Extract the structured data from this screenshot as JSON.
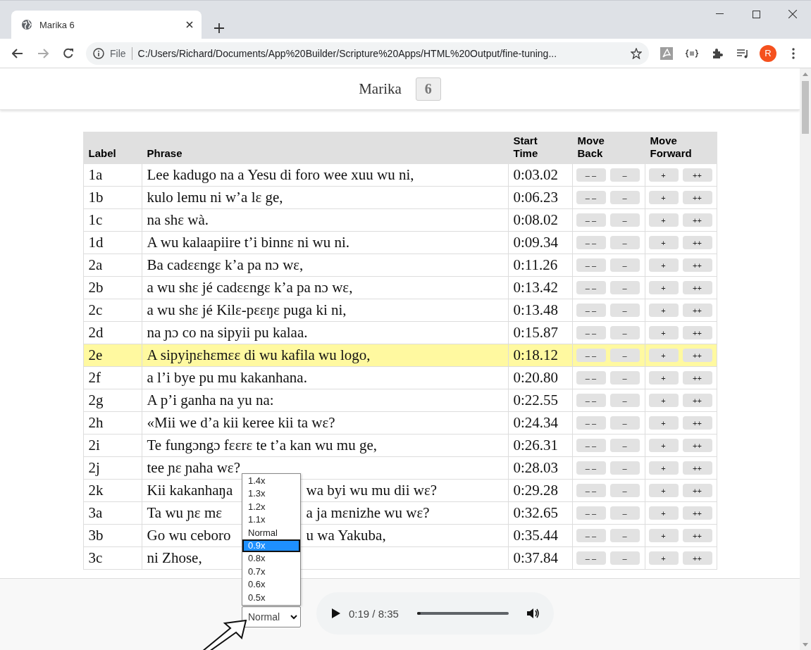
{
  "browser": {
    "tab": {
      "title": "Marika 6",
      "selected": true
    },
    "address": {
      "scheme": "File",
      "url": "C:/Users/Richard/Documents/App%20Builder/Scripture%20Apps/HTML%20Output/fine-tuning..."
    },
    "profile": "R"
  },
  "header": {
    "title": "Marika",
    "chapter": "6"
  },
  "table": {
    "columns": [
      {
        "lines": [
          "Label"
        ]
      },
      {
        "lines": [
          "Phrase"
        ]
      },
      {
        "lines": [
          "Start",
          "Time"
        ]
      },
      {
        "lines": [
          "Move",
          "Back"
        ]
      },
      {
        "lines": [
          "Move",
          "Forward"
        ]
      }
    ],
    "rows": [
      {
        "label": "1a",
        "phrase": [
          "Lee kadugo na a Yesu di foro wee xuu wu ni,"
        ],
        "start": "0:03.02",
        "back": [
          "– –",
          "–"
        ],
        "forward": [
          "+",
          "++"
        ],
        "selected": false
      },
      {
        "label": "1b",
        "phrase": [
          "kulo lemu ni w’a lɛ ge,"
        ],
        "start": "0:06.23",
        "back": [
          "– –",
          "–"
        ],
        "forward": [
          "+",
          "++"
        ],
        "selected": false
      },
      {
        "label": "1c",
        "phrase": [
          "na shɛ wà."
        ],
        "start": "0:08.02",
        "back": [
          "– –",
          "–"
        ],
        "forward": [
          "+",
          "++"
        ],
        "selected": false
      },
      {
        "label": "1d",
        "phrase": [
          "A wu kalaapiire t’i binnɛ ni wu ni."
        ],
        "start": "0:09.34",
        "back": [
          "– –",
          "–"
        ],
        "forward": [
          "+",
          "++"
        ],
        "selected": false
      },
      {
        "label": "2a",
        "phrase": [
          "Ba cadɛɛngɛ k’a pa nɔ wɛ,"
        ],
        "start": "0:11.26",
        "back": [
          "– –",
          "–"
        ],
        "forward": [
          "+",
          "++"
        ],
        "selected": false
      },
      {
        "label": "2b",
        "phrase": [
          "a wu shɛ jé cadɛɛngɛ k’a pa nɔ wɛ,"
        ],
        "start": "0:13.42",
        "back": [
          "– –",
          "–"
        ],
        "forward": [
          "+",
          "++"
        ],
        "selected": false
      },
      {
        "label": "2c",
        "phrase": [
          "a wu shɛ jé Kilɛ-pɛɛŋɛ puga ki ni,"
        ],
        "start": "0:13.48",
        "back": [
          "– –",
          "–"
        ],
        "forward": [
          "+",
          "++"
        ],
        "selected": false
      },
      {
        "label": "2d",
        "phrase": [
          "na ɲɔ co na sipyii pu kalaa."
        ],
        "start": "0:15.87",
        "back": [
          "– –",
          "–"
        ],
        "forward": [
          "+",
          "++"
        ],
        "selected": false
      },
      {
        "label": "2e",
        "phrase": [
          "A sipyiɲɛhɛmɛɛ di wu kafila wu logo,"
        ],
        "start": "0:18.12",
        "back": [
          "– –",
          "–"
        ],
        "forward": [
          "+",
          "++"
        ],
        "selected": true
      },
      {
        "label": "2f",
        "phrase": [
          "a l’i bye pu mu kakanhana."
        ],
        "start": "0:20.80",
        "back": [
          "– –",
          "–"
        ],
        "forward": [
          "+",
          "++"
        ],
        "selected": false
      },
      {
        "label": "2g",
        "phrase": [
          "A p’i ganha na yu na:"
        ],
        "start": "0:22.55",
        "back": [
          "– –",
          "–"
        ],
        "forward": [
          "+",
          "++"
        ],
        "selected": false
      },
      {
        "label": "2h",
        "phrase": [
          "«Mii we d’a kii keree kii ta wɛ?"
        ],
        "start": "0:24.34",
        "back": [
          "– –",
          "–"
        ],
        "forward": [
          "+",
          "++"
        ],
        "selected": false
      },
      {
        "label": "2i",
        "phrase": [
          "Te fungɔngɔ fɛɛrɛ te t’a kan wu mu ge,"
        ],
        "start": "0:26.31",
        "back": [
          "– –",
          "–"
        ],
        "forward": [
          "+",
          "++"
        ],
        "selected": false
      },
      {
        "label": "2j",
        "phrase": [
          "tee ɲɛ ɲaha wɛ?"
        ],
        "start": "0:28.03",
        "back": [
          "– –",
          "–"
        ],
        "forward": [
          "+",
          "++"
        ],
        "selected": false
      },
      {
        "label": "2k",
        "phrase": [
          "Kii kakanhaŋa",
          "wa byi wu mu dii wɛ?"
        ],
        "start": "0:29.28",
        "back": [
          "– –",
          "–"
        ],
        "forward": [
          "+",
          "++"
        ],
        "selected": false
      },
      {
        "label": "3a",
        "phrase": [
          "Ta wu ɲɛ mɛ",
          "a ja mɛnizhe wu wɛ?"
        ],
        "start": "0:32.65",
        "back": [
          "– –",
          "–"
        ],
        "forward": [
          "+",
          "++"
        ],
        "selected": false
      },
      {
        "label": "3b",
        "phrase": [
          "Go wu ceboro",
          "u wa Yakuba,"
        ],
        "start": "0:35.44",
        "back": [
          "– –",
          "–"
        ],
        "forward": [
          "+",
          "++"
        ],
        "selected": false
      },
      {
        "label": "3c",
        "phrase": [
          "ni Zhose,"
        ],
        "start": "0:37.84",
        "back": [
          "– –",
          "–"
        ],
        "forward": [
          "+",
          "++"
        ],
        "selected": false
      }
    ]
  },
  "speed": {
    "value": "Normal",
    "options": [
      {
        "label": "1.4x",
        "highlighted": false
      },
      {
        "label": "1.3x",
        "highlighted": false
      },
      {
        "label": "1.2x",
        "highlighted": false
      },
      {
        "label": "1.1x",
        "highlighted": false
      },
      {
        "label": "Normal",
        "highlighted": false
      },
      {
        "label": "0.9x",
        "highlighted": true
      },
      {
        "label": "0.8x",
        "highlighted": false
      },
      {
        "label": "0.7x",
        "highlighted": false
      },
      {
        "label": "0.6x",
        "highlighted": false
      },
      {
        "label": "0.5x",
        "highlighted": false
      }
    ]
  },
  "player": {
    "time": "0:19 / 8:35",
    "level": 0.04
  }
}
